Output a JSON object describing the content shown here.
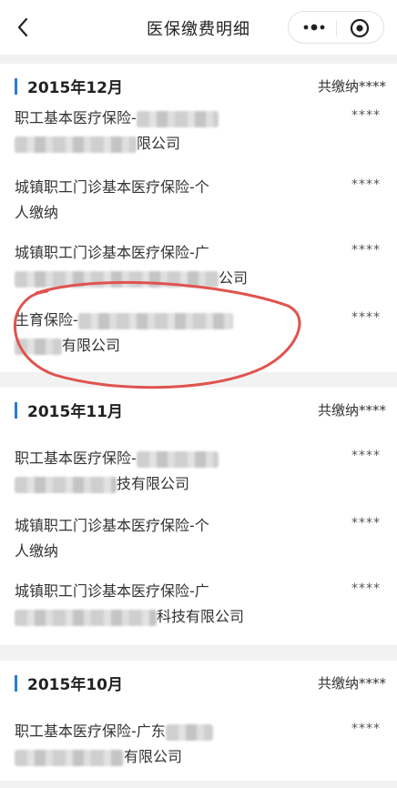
{
  "header": {
    "title": "医保缴费明细",
    "back_icon": "chevron-left-icon",
    "more_icon": "more-dots-icon",
    "close_icon": "target-close-icon"
  },
  "months": [
    {
      "month": "2015年12月",
      "total": "共缴纳****",
      "items": [
        {
          "line1": "职工基本医疗保险-",
          "line2": "限公司",
          "amount": "****"
        },
        {
          "line1": "城镇职工门诊基本医疗保险-个",
          "line2": "人缴纳",
          "amount": "****"
        },
        {
          "line1": "城镇职工门诊基本医疗保险-广",
          "line2": "公司",
          "amount": "****"
        },
        {
          "line1": "生育保险-",
          "line2": "有限公司",
          "amount": "****"
        }
      ]
    },
    {
      "month": "2015年11月",
      "total": "共缴纳****",
      "items": [
        {
          "line1": "职工基本医疗保险-",
          "line2": "技有限公司",
          "amount": "****"
        },
        {
          "line1": "城镇职工门诊基本医疗保险-个",
          "line2": "人缴纳",
          "amount": "****"
        },
        {
          "line1": "城镇职工门诊基本医疗保险-广",
          "line2": "科技有限公司",
          "amount": "****"
        }
      ]
    },
    {
      "month": "2015年10月",
      "total": "共缴纳****",
      "items": [
        {
          "line1": "职工基本医疗保险-广东",
          "line2": "有限公司",
          "amount": "****"
        }
      ]
    }
  ],
  "colors": {
    "accent": "#2d7bd6",
    "annotation": "#e0534f"
  }
}
